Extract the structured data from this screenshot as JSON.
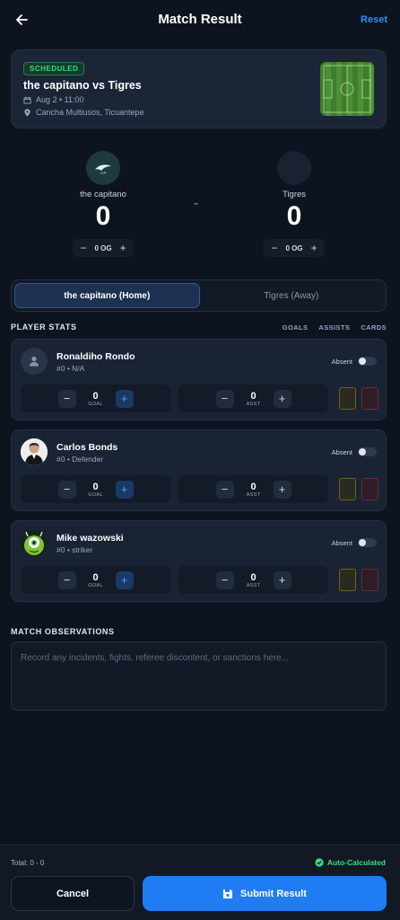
{
  "header": {
    "title": "Match Result",
    "reset_label": "Reset"
  },
  "match": {
    "status": "SCHEDULED",
    "title": "the capitano vs Tigres",
    "date": "Aug 2 • 11:00",
    "location": "Cancha Multiusos, Ticuantepe"
  },
  "home": {
    "name": "the capitano",
    "score": "0",
    "og": "0 OG"
  },
  "away": {
    "name": "Tigres",
    "score": "0",
    "og": "0 OG"
  },
  "score_separator": "-",
  "tabs": [
    {
      "label": "the capitano (Home)"
    },
    {
      "label": "Tigres (Away)"
    }
  ],
  "player_stats": {
    "title": "PLAYER STATS",
    "columns": [
      "GOALS",
      "ASSISTS",
      "CARDS"
    ],
    "players": [
      {
        "name": "Ronaldiho Rondo",
        "info": "#0 • N/A",
        "absent_label": "Absent",
        "goals": "0",
        "goal_unit": "GOAL",
        "assists": "0",
        "assist_unit": "ASST"
      },
      {
        "name": "Carlos Bonds",
        "info": "#0 • Defender",
        "absent_label": "Absent",
        "goals": "0",
        "goal_unit": "GOAL",
        "assists": "0",
        "assist_unit": "ASST"
      },
      {
        "name": "Mike wazowski",
        "info": "#0 • striker",
        "absent_label": "Absent",
        "goals": "0",
        "goal_unit": "GOAL",
        "assists": "0",
        "assist_unit": "ASST"
      }
    ]
  },
  "observations": {
    "title": "MATCH OBSERVATIONS",
    "placeholder": "Record any incidents, fights, referee discontent, or sanctions here..."
  },
  "footer": {
    "total": "Total: 0 - 0",
    "auto": "Auto-Calculated",
    "cancel": "Cancel",
    "submit": "Submit Result"
  },
  "colors": {
    "accent": "#1f7cf2",
    "success": "#3ddc84",
    "background": "#0d1420"
  }
}
